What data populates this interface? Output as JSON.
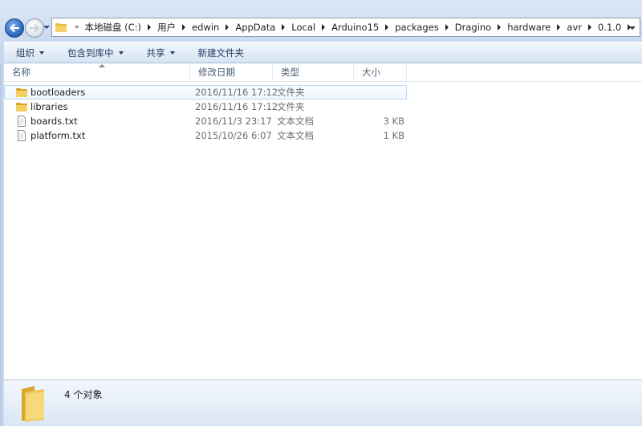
{
  "address_bar": {
    "overflow_chevron": "«",
    "crumbs": [
      "本地磁盘 (C:)",
      "用户",
      "edwin",
      "AppData",
      "Local",
      "Arduino15",
      "packages",
      "Dragino",
      "hardware",
      "avr",
      "0.1.0"
    ]
  },
  "toolbar": {
    "organize_label": "组织",
    "include_library_label": "包含到库中",
    "share_label": "共享",
    "new_folder_label": "新建文件夹"
  },
  "columns": {
    "name": "名称",
    "date_modified": "修改日期",
    "type": "类型",
    "size": "大小"
  },
  "files": [
    {
      "name": "bootloaders",
      "date": "2016/11/16 17:12",
      "type": "文件夹",
      "size": "",
      "icon": "folder-icon"
    },
    {
      "name": "libraries",
      "date": "2016/11/16 17:12",
      "type": "文件夹",
      "size": "",
      "icon": "folder-icon"
    },
    {
      "name": "boards.txt",
      "date": "2016/11/3 23:17",
      "type": "文本文档",
      "size": "3 KB",
      "icon": "text-file-icon"
    },
    {
      "name": "platform.txt",
      "date": "2015/10/26 6:07",
      "type": "文本文档",
      "size": "1 KB",
      "icon": "text-file-icon"
    }
  ],
  "details": {
    "item_count": "4 个对象"
  },
  "colors": {
    "folder": "#e8b93a",
    "selection_border": "#b8d6fb",
    "command_text": "#1e3a5f"
  }
}
